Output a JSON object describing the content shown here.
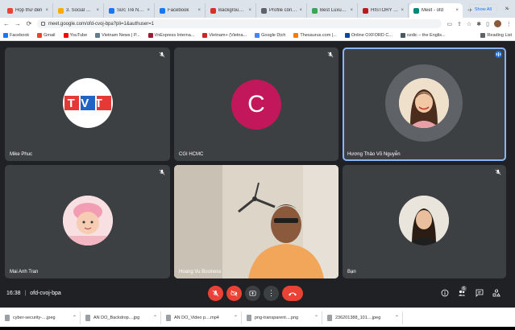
{
  "browser": {
    "tabs": [
      {
        "title": "Hộp thư đến",
        "color": "#ea4335"
      },
      {
        "title": "3. Social Secu",
        "color": "#f9ab00"
      },
      {
        "title": "Sức Trẻ Nhân",
        "color": "#1877f2"
      },
      {
        "title": "Facebook",
        "color": "#1877f2"
      },
      {
        "title": "Background P",
        "color": "#d93025"
      },
      {
        "title": "Profile công ty",
        "color": "#5f6368"
      },
      {
        "title": "Best Luxury V",
        "color": "#34a853"
      },
      {
        "title": "HISTORY OF S",
        "color": "#b71c1c"
      },
      {
        "title": "Meet - ofd",
        "color": "#00897b"
      }
    ],
    "active_tab_index": 8,
    "url": "meet.google.com/ofd-cvoj-bpa?pli=1&authuser=1",
    "bookmarks": [
      {
        "label": "Facebook",
        "color": "#1877f2"
      },
      {
        "label": "Gmail",
        "color": "#ea4335"
      },
      {
        "label": "YouTube",
        "color": "#ff0000"
      },
      {
        "label": "Vietnam News | P...",
        "color": "#607d8b"
      },
      {
        "label": "VnExpress Interna...",
        "color": "#9e1b32"
      },
      {
        "label": "Vietnam+ (Vietna...",
        "color": "#c62828"
      },
      {
        "label": "Google Dịch",
        "color": "#4285f4"
      },
      {
        "label": "Thesaurus.com |...",
        "color": "#f57c00"
      },
      {
        "label": "Online OXFORD C...",
        "color": "#0d47a1"
      },
      {
        "label": "ozdic – the Englis...",
        "color": "#455a64"
      }
    ],
    "reading_list": "Reading List"
  },
  "participants": [
    {
      "name": "Mike Phuc",
      "avatar": "tvt-logo",
      "muted": true
    },
    {
      "name": "CGI HCMC",
      "avatar": "letter",
      "letter": "C",
      "avatar_color": "#c2185b",
      "muted": true
    },
    {
      "name": "Hương Thảo Võ Nguyễn",
      "avatar": "photo",
      "muted": false,
      "speaking": true
    },
    {
      "name": "Mai Anh Tran",
      "avatar": "baby-photo",
      "muted": true
    },
    {
      "name": "Hoang Vu Business",
      "avatar": "camera",
      "muted": false
    },
    {
      "name": "Bạn",
      "avatar": "photo",
      "muted": true
    }
  ],
  "logo_text": "TVT",
  "meeting": {
    "time": "16:38",
    "separator": "|",
    "code": "ofd-cvoj-bpa",
    "participant_count": "6"
  },
  "downloads": {
    "items": [
      "cyber-security-....jpeg",
      "AN DO_Backdrop....jpg",
      "AN DO_Video p....mp4",
      "png-transparent....png",
      "236201388_101....jpeg"
    ],
    "show_all": "Show All"
  },
  "colors": {
    "meet_bg": "#202124",
    "tile_bg": "#3c4043",
    "end_call_red": "#ea4335",
    "speaking_blue": "#8ab4f8"
  }
}
